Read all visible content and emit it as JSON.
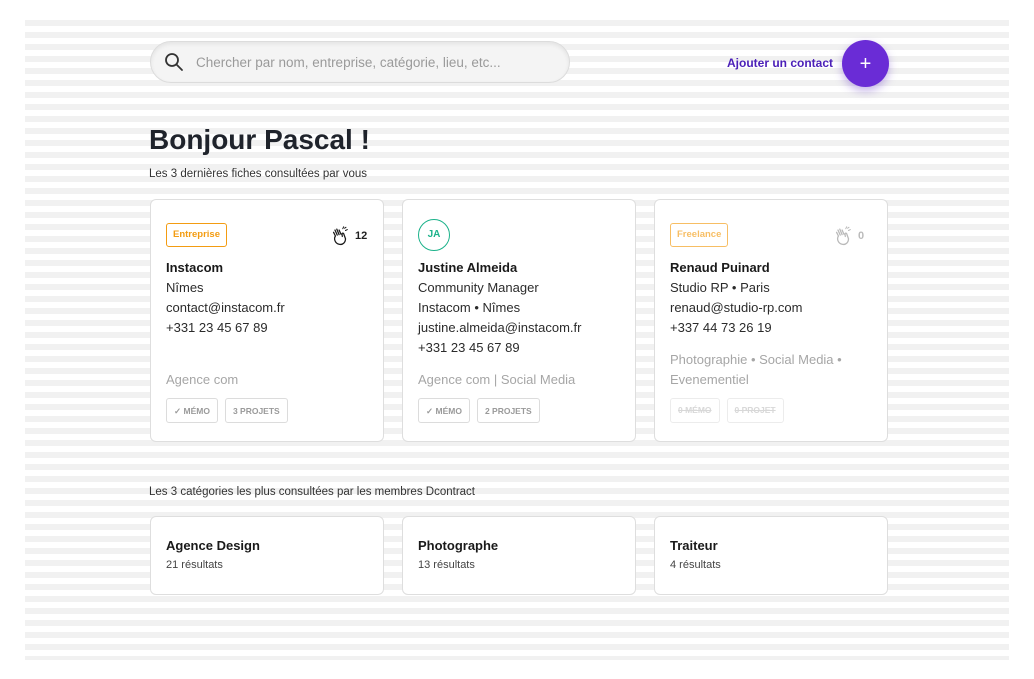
{
  "search": {
    "placeholder": "Chercher par nom, entreprise, catégorie, lieu, etc..."
  },
  "header": {
    "add_contact_label": "Ajouter un contact",
    "add_button_label": "+",
    "accent_color": "#6a2cd6"
  },
  "greeting": "Bonjour Pascal !",
  "recent": {
    "subtitle": "Les 3 dernières fiches consultées  par vous",
    "cards": [
      {
        "badge": "Entreprise",
        "claps": "12",
        "lines": [
          "Instacom",
          "Nîmes",
          "contact@instacom.fr",
          "+331 23 45 67 89"
        ],
        "tags": "Agence com",
        "chips": [
          "✓ MÉMO",
          "3 PROJETS"
        ]
      },
      {
        "avatar": "JA",
        "lines": [
          "Justine Almeida",
          "Community Manager",
          "Instacom • Nîmes",
          "justine.almeida@instacom.fr",
          "+331 23 45 67 89"
        ],
        "tags": "Agence com | Social Media",
        "chips": [
          "✓ MÉMO",
          "2 PROJETS"
        ]
      },
      {
        "badge": "Freelance",
        "claps": "0",
        "lines": [
          "Renaud Puinard",
          "Studio RP • Paris",
          "renaud@studio-rp.com",
          "+337 44 73 26 19"
        ],
        "tags_line1": "Photographie • Social Media •",
        "tags_line2": "Evenementiel",
        "chips": [
          "0 MÉMO",
          "0 PROJET"
        ]
      }
    ]
  },
  "categories": {
    "subtitle": "Les 3 catégories les plus consultées  par les membres Dcontract",
    "items": [
      {
        "title": "Agence Design",
        "count": "21 résultats"
      },
      {
        "title": "Photographe",
        "count": "13 résultats"
      },
      {
        "title": "Traiteur",
        "count": "4 résultats"
      }
    ]
  },
  "colors": {
    "badge_orange": "#f39c12",
    "avatar_green": "#1bb28a",
    "link_purple": "#4b1fb8"
  }
}
